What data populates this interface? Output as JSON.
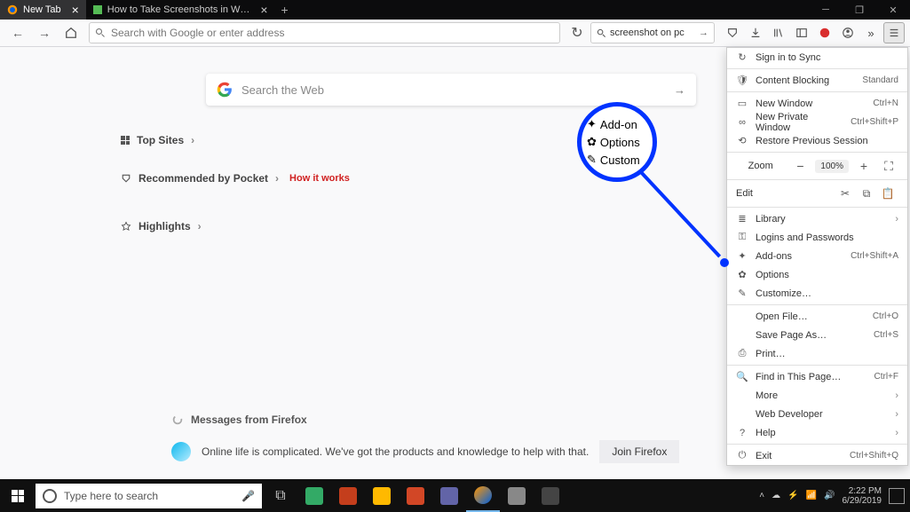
{
  "tabs": {
    "active": {
      "title": "New Tab"
    },
    "other": {
      "title": "How to Take Screenshots in W…"
    }
  },
  "urlbar": {
    "placeholder": "Search with Google or enter address"
  },
  "searchbar": {
    "value": "screenshot on pc"
  },
  "newtab": {
    "search_placeholder": "Search the Web",
    "top_sites": "Top Sites",
    "pocket": "Recommended by Pocket",
    "pocket_how": "How it works",
    "highlights": "Highlights",
    "messages": "Messages from Firefox",
    "footer_text": "Online life is complicated. We've got the products and knowledge to help with that.",
    "join": "Join Firefox"
  },
  "zoom_circle": {
    "a": "Add-on",
    "b": "Options",
    "c": "Custom"
  },
  "menu": {
    "sign_in": "Sign in to Sync",
    "content_blocking": "Content Blocking",
    "content_blocking_val": "Standard",
    "new_window": "New Window",
    "new_window_key": "Ctrl+N",
    "new_private": "New Private Window",
    "new_private_key": "Ctrl+Shift+P",
    "restore": "Restore Previous Session",
    "zoom": "Zoom",
    "zoom_pct": "100%",
    "edit": "Edit",
    "library": "Library",
    "logins": "Logins and Passwords",
    "addons": "Add-ons",
    "addons_key": "Ctrl+Shift+A",
    "options": "Options",
    "customize": "Customize…",
    "open_file": "Open File…",
    "open_file_key": "Ctrl+O",
    "save_page": "Save Page As…",
    "save_page_key": "Ctrl+S",
    "print": "Print…",
    "find": "Find in This Page…",
    "find_key": "Ctrl+F",
    "more": "More",
    "webdev": "Web Developer",
    "help": "Help",
    "exit": "Exit",
    "exit_key": "Ctrl+Shift+Q"
  },
  "taskbar": {
    "search_placeholder": "Type here to search",
    "time": "2:22 PM",
    "date": "6/29/2019"
  }
}
